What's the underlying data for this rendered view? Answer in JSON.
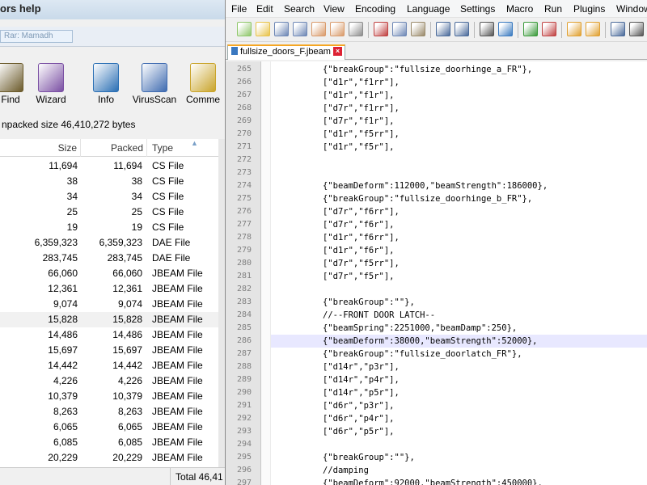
{
  "left_window": {
    "title": "ors help",
    "address": "Rar: Mamadh",
    "toolbar": [
      {
        "label": "Find",
        "icon": "binoculars-icon",
        "color": "#6b5a2a"
      },
      {
        "label": "Wizard",
        "icon": "wizard-icon",
        "color": "#7a4fa3"
      },
      {
        "label": "Info",
        "icon": "info-icon",
        "color": "#2a6fb4"
      },
      {
        "label": "VirusScan",
        "icon": "virusscan-icon",
        "color": "#3f6bb0"
      },
      {
        "label": "Comme",
        "icon": "comment-icon",
        "color": "#c9a42a"
      }
    ],
    "status": "npacked size 46,410,272 bytes",
    "columns": {
      "size": "Size",
      "packed": "Packed",
      "type": "Type"
    },
    "rows": [
      {
        "size": "11,694",
        "packed": "11,694",
        "type": "CS File"
      },
      {
        "size": "38",
        "packed": "38",
        "type": "CS File"
      },
      {
        "size": "34",
        "packed": "34",
        "type": "CS File"
      },
      {
        "size": "25",
        "packed": "25",
        "type": "CS File"
      },
      {
        "size": "19",
        "packed": "19",
        "type": "CS File"
      },
      {
        "size": "6,359,323",
        "packed": "6,359,323",
        "type": "DAE File"
      },
      {
        "size": "283,745",
        "packed": "283,745",
        "type": "DAE File"
      },
      {
        "size": "66,060",
        "packed": "66,060",
        "type": "JBEAM File"
      },
      {
        "size": "12,361",
        "packed": "12,361",
        "type": "JBEAM File"
      },
      {
        "size": "9,074",
        "packed": "9,074",
        "type": "JBEAM File"
      },
      {
        "size": "15,828",
        "packed": "15,828",
        "type": "JBEAM File"
      },
      {
        "size": "14,486",
        "packed": "14,486",
        "type": "JBEAM File"
      },
      {
        "size": "15,697",
        "packed": "15,697",
        "type": "JBEAM File"
      },
      {
        "size": "14,442",
        "packed": "14,442",
        "type": "JBEAM File"
      },
      {
        "size": "4,226",
        "packed": "4,226",
        "type": "JBEAM File"
      },
      {
        "size": "10,379",
        "packed": "10,379",
        "type": "JBEAM File"
      },
      {
        "size": "8,263",
        "packed": "8,263",
        "type": "JBEAM File"
      },
      {
        "size": "6,065",
        "packed": "6,065",
        "type": "JBEAM File"
      },
      {
        "size": "6,085",
        "packed": "6,085",
        "type": "JBEAM File"
      },
      {
        "size": "20,229",
        "packed": "20,229",
        "type": "JBEAM File"
      }
    ],
    "selected_row": 10,
    "footer_total": "Total 46,41"
  },
  "editor": {
    "menu": [
      "File",
      "Edit",
      "Search",
      "View",
      "Encoding",
      "Language",
      "Settings",
      "Macro",
      "Run",
      "Plugins",
      "Window"
    ],
    "toolbar_icons": [
      {
        "name": "new-file-icon",
        "color": "#8fc76a"
      },
      {
        "name": "open-file-icon",
        "color": "#e8c34a"
      },
      {
        "name": "save-icon",
        "color": "#6d87b5"
      },
      {
        "name": "save-all-icon",
        "color": "#6d87b5"
      },
      {
        "name": "close-icon",
        "color": "#d99a6a"
      },
      {
        "name": "close-all-icon",
        "color": "#d99a6a"
      },
      {
        "name": "print-icon",
        "color": "#8d8d8d"
      },
      {
        "name": "cut-icon",
        "color": "#c04040"
      },
      {
        "name": "copy-icon",
        "color": "#6d87b5"
      },
      {
        "name": "paste-icon",
        "color": "#9a8a6a"
      },
      {
        "name": "undo-icon",
        "color": "#4a6a9a"
      },
      {
        "name": "redo-icon",
        "color": "#4a6a9a"
      },
      {
        "name": "find-icon",
        "color": "#555555"
      },
      {
        "name": "replace-icon",
        "color": "#3a7ac0"
      },
      {
        "name": "zoom-in-icon",
        "color": "#3a9a3a"
      },
      {
        "name": "zoom-out-icon",
        "color": "#c04040"
      },
      {
        "name": "sync-v-icon",
        "color": "#e0a030"
      },
      {
        "name": "sync-h-icon",
        "color": "#e0a030"
      },
      {
        "name": "wrap-icon",
        "color": "#4a6a9a"
      },
      {
        "name": "all-chars-icon",
        "color": "#555555"
      }
    ],
    "tab_label": "fullsize_doors_F.jbeam",
    "lines": [
      {
        "n": "265",
        "text": "{\"breakGroup\":\"fullsize_doorhinge_a_FR\"},"
      },
      {
        "n": "266",
        "text": "[\"d1r\",\"f1rr\"],"
      },
      {
        "n": "267",
        "text": "[\"d1r\",\"f1r\"],"
      },
      {
        "n": "268",
        "text": "[\"d7r\",\"f1rr\"],"
      },
      {
        "n": "269",
        "text": "[\"d7r\",\"f1r\"],"
      },
      {
        "n": "270",
        "text": "[\"d1r\",\"f5rr\"],"
      },
      {
        "n": "271",
        "text": "[\"d1r\",\"f5r\"],"
      },
      {
        "n": "272",
        "text": ""
      },
      {
        "n": "273",
        "text": ""
      },
      {
        "n": "274",
        "text": "{\"beamDeform\":112000,\"beamStrength\":186000},"
      },
      {
        "n": "275",
        "text": "{\"breakGroup\":\"fullsize_doorhinge_b_FR\"},"
      },
      {
        "n": "276",
        "text": "[\"d7r\",\"f6rr\"],"
      },
      {
        "n": "277",
        "text": "[\"d7r\",\"f6r\"],"
      },
      {
        "n": "278",
        "text": "[\"d1r\",\"f6rr\"],"
      },
      {
        "n": "279",
        "text": "[\"d1r\",\"f6r\"],"
      },
      {
        "n": "280",
        "text": "[\"d7r\",\"f5rr\"],"
      },
      {
        "n": "281",
        "text": "[\"d7r\",\"f5r\"],"
      },
      {
        "n": "282",
        "text": ""
      },
      {
        "n": "283",
        "text": "{\"breakGroup\":\"\"},"
      },
      {
        "n": "284",
        "text": "//--FRONT DOOR LATCH--"
      },
      {
        "n": "285",
        "text": "{\"beamSpring\":2251000,\"beamDamp\":250},"
      },
      {
        "n": "286",
        "text": "{\"beamDeform\":38000,\"beamStrength\":52000},"
      },
      {
        "n": "287",
        "text": "{\"breakGroup\":\"fullsize_doorlatch_FR\"},"
      },
      {
        "n": "288",
        "text": "[\"d14r\",\"p3r\"],"
      },
      {
        "n": "289",
        "text": "[\"d14r\",\"p4r\"],"
      },
      {
        "n": "290",
        "text": "[\"d14r\",\"p5r\"],"
      },
      {
        "n": "291",
        "text": "[\"d6r\",\"p3r\"],"
      },
      {
        "n": "292",
        "text": "[\"d6r\",\"p4r\"],"
      },
      {
        "n": "293",
        "text": "[\"d6r\",\"p5r\"],"
      },
      {
        "n": "294",
        "text": ""
      },
      {
        "n": "295",
        "text": "{\"breakGroup\":\"\"},"
      },
      {
        "n": "296",
        "text": "//damping"
      },
      {
        "n": "297",
        "text": "{\"beamDeform\":92000,\"beamStrength\":450000},"
      }
    ],
    "highlighted_line": "286",
    "highlight_color": "#e8e8ff"
  }
}
